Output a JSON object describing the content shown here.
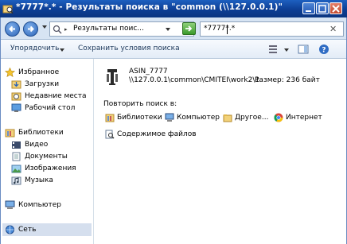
{
  "window": {
    "title": "*7777*.* - Результаты поиска в \"common (\\\\127.0.0.1)\"",
    "controls": [
      "minimize",
      "maximize",
      "close"
    ]
  },
  "navbar": {
    "address_text": "Результаты поис...",
    "address_arrow": "▸",
    "search_value": "*7777*.*",
    "search_clear": "✕"
  },
  "toolbar": {
    "organize_label": "Упорядочить",
    "save_search_label": "Сохранить условия поиска"
  },
  "sidebar": {
    "favorites_label": "Избранное",
    "downloads_label": "Загрузки",
    "recent_label": "Недавние места",
    "desktop_label": "Рабочий стол",
    "libraries_label": "Библиотеки",
    "video_label": "Видео",
    "documents_label": "Документы",
    "images_label": "Изображения",
    "music_label": "Музыка",
    "computer_label": "Компьютер",
    "network_label": "Сеть"
  },
  "result": {
    "name": "ASIN_7777",
    "path": "\\\\127.0.0.1\\common\\CMITEI\\work2\\1",
    "size": "Размер: 236 байт"
  },
  "search_again": {
    "heading": "Повторить поиск в:",
    "libraries": "Библиотеки",
    "computer": "Компьютер",
    "other": "Другое...",
    "internet": "Интернет",
    "file_contents": "Содержимое файлов"
  }
}
